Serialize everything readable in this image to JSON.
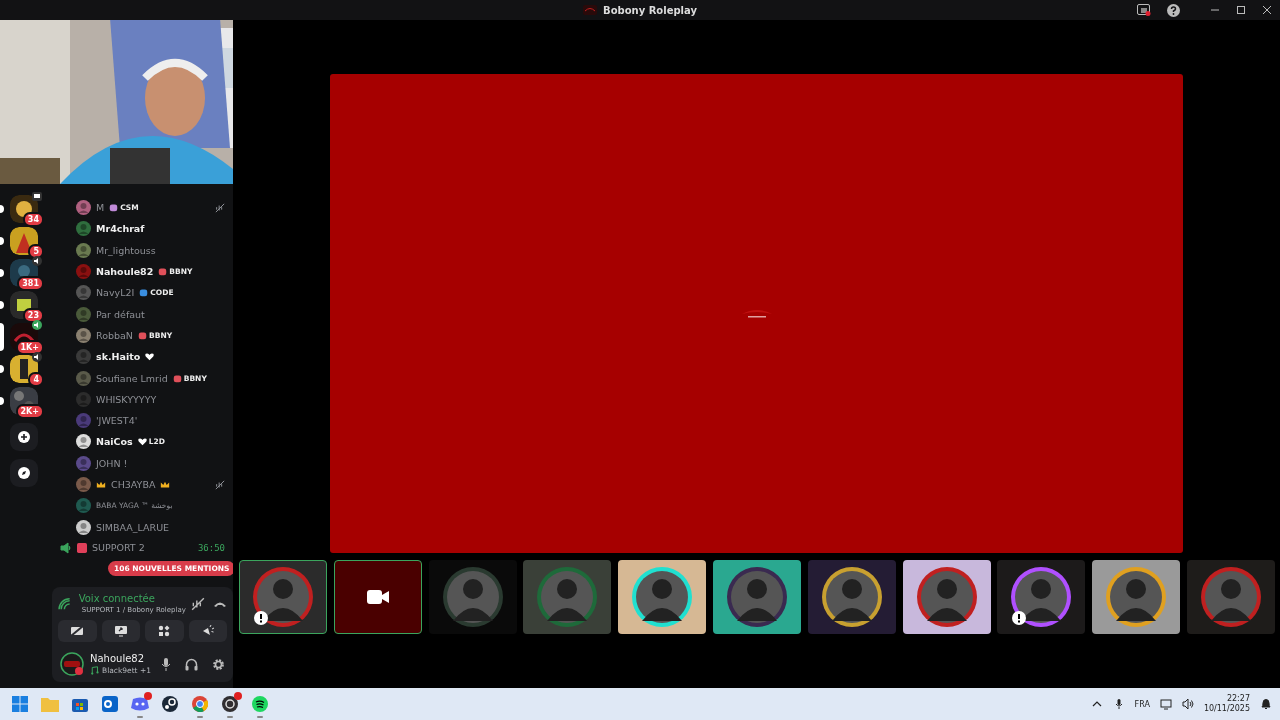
{
  "window": {
    "title": "Bobony Roleplay"
  },
  "servers": [
    {
      "badge": "34",
      "screen": true,
      "voice": false,
      "speaking": false,
      "unread": true,
      "selected": false
    },
    {
      "badge": "5",
      "screen": false,
      "voice": false,
      "speaking": false,
      "unread": true,
      "selected": false
    },
    {
      "badge": "381",
      "screen": false,
      "voice": true,
      "speaking": false,
      "unread": true,
      "selected": false
    },
    {
      "badge": "23",
      "screen": false,
      "voice": false,
      "speaking": false,
      "unread": true,
      "selected": false
    },
    {
      "badge": "1K+",
      "screen": false,
      "voice": true,
      "speaking": true,
      "unread": false,
      "selected": true
    },
    {
      "badge": "4",
      "screen": false,
      "voice": true,
      "speaking": false,
      "unread": true,
      "selected": false
    },
    {
      "badge": "2K+",
      "screen": false,
      "voice": false,
      "speaking": false,
      "unread": true,
      "selected": false
    }
  ],
  "members": [
    {
      "name": "M",
      "strong": false,
      "small": false,
      "crowned": false,
      "muted": true,
      "tag": {
        "kind": "role",
        "text": "CSM",
        "color": "#c08ad8"
      }
    },
    {
      "name": "Mr4chraf",
      "strong": true,
      "small": false,
      "crowned": false,
      "muted": false
    },
    {
      "name": "Mr_lightouss",
      "strong": false,
      "small": false,
      "crowned": false,
      "muted": false
    },
    {
      "name": "Nahoule82",
      "strong": true,
      "small": false,
      "crowned": false,
      "muted": false,
      "tag": {
        "kind": "role",
        "text": "BBNY",
        "color": "#e0505a"
      }
    },
    {
      "name": "NavyL2I",
      "strong": false,
      "small": false,
      "crowned": false,
      "muted": false,
      "tag": {
        "kind": "role",
        "text": "CODE",
        "color": "#3a8ee0"
      }
    },
    {
      "name": "Par défaut",
      "strong": false,
      "small": false,
      "crowned": false,
      "muted": false
    },
    {
      "name": "RobbaN",
      "strong": false,
      "small": false,
      "crowned": false,
      "muted": false,
      "tag": {
        "kind": "role",
        "text": "BBNY",
        "color": "#e0505a"
      }
    },
    {
      "name": "sk.Haito",
      "strong": true,
      "small": false,
      "crowned": false,
      "muted": false,
      "tag": {
        "kind": "heart",
        "color": "#ffffff"
      }
    },
    {
      "name": "Soufiane Lmrid",
      "strong": false,
      "small": false,
      "crowned": false,
      "muted": false,
      "tag": {
        "kind": "role",
        "text": "BBNY",
        "color": "#e0505a"
      }
    },
    {
      "name": "WHISKYYYYY",
      "strong": false,
      "small": false,
      "crowned": false,
      "muted": false
    },
    {
      "name": "'JWEST4'",
      "strong": false,
      "small": false,
      "crowned": false,
      "muted": false
    },
    {
      "name": "NaiCos",
      "strong": true,
      "small": false,
      "crowned": false,
      "muted": false,
      "tag": {
        "kind": "heart",
        "text": "L2D",
        "color": "#ffffff"
      }
    },
    {
      "name": "JOHN !",
      "strong": false,
      "small": false,
      "crowned": false,
      "muted": false
    },
    {
      "name": "CH3AYBA",
      "strong": false,
      "small": false,
      "crowned": true,
      "muted": true
    },
    {
      "name": "BABA YAGA ™ بوخشة",
      "strong": false,
      "small": true,
      "crowned": false,
      "muted": false
    },
    {
      "name": "SIMBAA_LARUE",
      "strong": false,
      "small": false,
      "crowned": false,
      "muted": false
    }
  ],
  "channel": {
    "name": "SUPPORT 2",
    "timer": "36:50"
  },
  "mentions": "106 NOUVELLES MENTIONS",
  "voice": {
    "status": "Voix connectée",
    "location": "SUPPORT 1 / Bobony Roleplay"
  },
  "user": {
    "name": "Nahoule82",
    "activity": "Black9ett +1"
  },
  "tiles": [
    {
      "kind": "avatar",
      "selected": true,
      "alert": true
    },
    {
      "kind": "camera",
      "selected": true,
      "alert": false
    },
    {
      "kind": "avatar",
      "selected": false,
      "alert": false
    },
    {
      "kind": "avatar",
      "selected": false,
      "alert": false
    },
    {
      "kind": "avatar",
      "selected": false,
      "alert": false
    },
    {
      "kind": "avatar",
      "selected": false,
      "alert": false
    },
    {
      "kind": "avatar",
      "selected": false,
      "alert": false
    },
    {
      "kind": "avatar",
      "selected": false,
      "alert": false
    },
    {
      "kind": "avatar",
      "selected": false,
      "alert": true
    },
    {
      "kind": "avatar",
      "selected": false,
      "alert": false
    },
    {
      "kind": "avatar",
      "selected": false,
      "alert": false
    }
  ],
  "taskbar": {
    "apps": [
      {
        "kind": "folder",
        "badge": false,
        "running": false
      },
      {
        "kind": "store",
        "badge": false,
        "running": false
      },
      {
        "kind": "outlook",
        "badge": false,
        "running": false
      },
      {
        "kind": "discord",
        "badge": true,
        "running": true
      },
      {
        "kind": "steam",
        "badge": false,
        "running": false
      },
      {
        "kind": "chrome",
        "badge": false,
        "running": true
      },
      {
        "kind": "obs",
        "badge": true,
        "running": true
      },
      {
        "kind": "spotify",
        "badge": false,
        "running": true
      }
    ],
    "language": "FRA",
    "time": "22:27",
    "date": "10/11/2025"
  }
}
